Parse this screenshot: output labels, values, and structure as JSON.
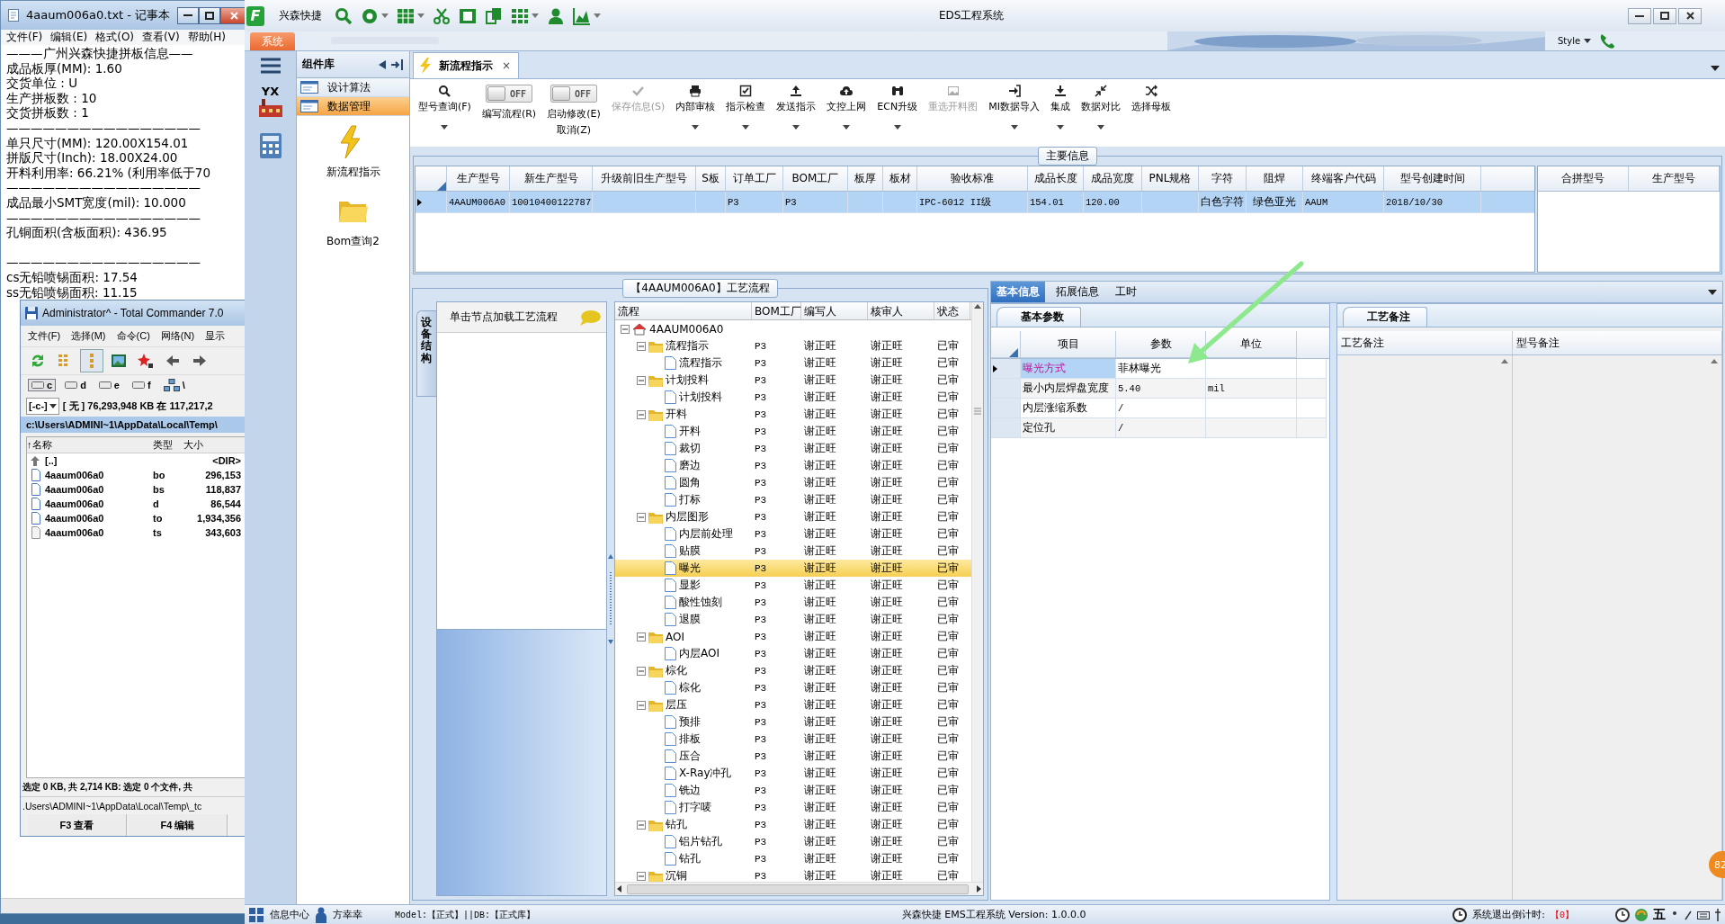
{
  "notepad": {
    "title": "4aaum006a0.txt - 记事本",
    "menu": [
      "文件(F)",
      "编辑(E)",
      "格式(O)",
      "查看(V)",
      "帮助(H)"
    ],
    "paragraphs": [
      [
        "———广州兴森快捷拼板信息——",
        "成品板厚(MM): 1.60",
        "交货单位 : U",
        "生产拼板数 : 10",
        "交货拼板数 : 1",
        "————————————————",
        "单只尺寸(MM): 120.00X154.01",
        "拼版尺寸(Inch): 18.00X24.00",
        "开料利用率: 66.21% (利用率低于70",
        "————————————————",
        "成品最小SMT宽度(mil): 10.000",
        "————————————————",
        "孔铜面积(含板面积): 436.95"
      ],
      [
        "————————————————",
        "cs无铅喷锡面积: 17.54",
        "ss无铅喷锡面积: 11.15"
      ]
    ]
  },
  "total_commander": {
    "title": "Administrator^ - Total Commander 7.0",
    "menu": [
      "文件(F)",
      "选择(M)",
      "命令(C)",
      "网络(N)",
      "显示"
    ],
    "tools": [
      {
        "selected": false
      },
      {
        "selected": false
      },
      {
        "selected": true
      },
      {
        "selected": false
      },
      {
        "selected": false
      },
      {
        "selected": false
      },
      {
        "selected": false
      }
    ],
    "drives": [
      {
        "label": "c",
        "selected": true
      },
      {
        "label": "d",
        "selected": false
      },
      {
        "label": "e",
        "selected": false
      },
      {
        "label": "f",
        "selected": false
      }
    ],
    "root": "\\",
    "drive_select": "[-c-]",
    "free_space": "[ 无 ]  76,293,948 KB 在 117,217,2",
    "path": "c:\\Users\\ADMINI~1\\AppData\\Local\\Temp\\",
    "columns": [
      "↑名称",
      "类型",
      "大小"
    ],
    "files": [
      {
        "kind": "up",
        "name": "[..]",
        "size": "<DIR>"
      },
      {
        "kind": "file",
        "name": "4aaum006a0",
        "type": "bo",
        "size": "296,153"
      },
      {
        "kind": "file",
        "name": "4aaum006a0",
        "type": "bs",
        "size": "118,837"
      },
      {
        "kind": "file",
        "name": "4aaum006a0",
        "type": "d",
        "size": "86,544"
      },
      {
        "kind": "file",
        "name": "4aaum006a0",
        "type": "to",
        "size": "1,934,356"
      },
      {
        "kind": "md",
        "name": "4aaum006a0",
        "type": "ts",
        "size": "343,603"
      }
    ],
    "status": "选定 0 KB, 共 2,714 KB: 选定 0 个文件, 共",
    "command_path": ".Users\\ADMINI~1\\AppData\\Local\\Temp\\_tc",
    "function_keys": [
      "F3 查看",
      "F4 编辑"
    ]
  },
  "app": {
    "logo_letter": "F",
    "name": "兴森快捷",
    "title": "EDS工程系统",
    "quick_tools": [
      {
        "menu": false
      },
      {
        "menu": true
      },
      {
        "menu": true
      },
      {
        "menu": false
      },
      {
        "menu": false
      },
      {
        "menu": false
      },
      {
        "menu": true
      },
      {
        "menu": false
      },
      {
        "menu": true
      }
    ],
    "system_tab": "系统",
    "style_menu": "Style",
    "nav_brand": "YX",
    "components": {
      "title": "组件库",
      "groups": [
        {
          "label": "设计算法",
          "selected": false
        },
        {
          "label": "数据管理",
          "selected": true
        }
      ],
      "shortcuts": [
        {
          "kind": "lightning",
          "label": "新流程指示"
        },
        {
          "kind": "folder",
          "label": "Bom查询2"
        }
      ]
    },
    "document_tab": {
      "label": "新流程指示",
      "close": "×"
    },
    "toolbar": [
      {
        "kind": "button",
        "label": "型号查询(F)",
        "menu": true,
        "disabled": false
      },
      {
        "kind": "toggle",
        "label": "编写流程(R)",
        "switch_text": "OFF",
        "on": false
      },
      {
        "kind": "toggle",
        "label": "启动修改(E)",
        "second_line": "取消(Z)",
        "switch_text": "OFF",
        "on": false
      },
      {
        "kind": "button",
        "label": "保存信息(S)",
        "menu": false,
        "disabled": true
      },
      {
        "kind": "button",
        "label": "内部审核",
        "menu": true,
        "disabled": false
      },
      {
        "kind": "button",
        "label": "指示检查",
        "menu": true,
        "disabled": false
      },
      {
        "kind": "button",
        "label": "发送指示",
        "menu": true,
        "disabled": false
      },
      {
        "kind": "button",
        "label": "文控上网",
        "menu": true,
        "disabled": false
      },
      {
        "kind": "button",
        "label": "ECN升级",
        "menu": true,
        "disabled": false
      },
      {
        "kind": "button",
        "label": "重选开料图",
        "menu": false,
        "disabled": true
      },
      {
        "kind": "button",
        "label": "MI数据导入",
        "menu": true,
        "disabled": false
      },
      {
        "kind": "button",
        "label": "集成",
        "menu": true,
        "disabled": false
      },
      {
        "kind": "button",
        "label": "数据对比",
        "menu": true,
        "disabled": false
      },
      {
        "kind": "button",
        "label": "选择母板",
        "menu": false,
        "disabled": false
      }
    ],
    "main_info": {
      "legend": "主要信息",
      "columns": [
        "生产型号",
        "新生产型号",
        "升级前旧生产型号",
        "S板",
        "订单工厂",
        "BOM工厂",
        "板厚",
        "板材",
        "验收标准",
        "成品长度",
        "成品宽度",
        "PNL规格",
        "字符",
        "阻焊",
        "终端客户代码",
        "型号创建时间"
      ],
      "rows": [
        {
          "selected": true,
          "cells": [
            "4AAUM006A0",
            "10010400122787",
            null,
            null,
            "P3",
            "P3",
            null,
            null,
            "IPC-6012 II级",
            "154.01",
            "120.00",
            null,
            "白色字符",
            "绿色亚光",
            "AAUM",
            "2018/10/30"
          ]
        }
      ],
      "merge_columns": [
        "合拼型号",
        "生产型号"
      ]
    },
    "process": {
      "legend": "【4AAUM006A0】工艺流程",
      "side_tab": "设备结构",
      "hint": "单击节点加载工艺流程",
      "columns": [
        "流程",
        "BOM工厂",
        "编写人",
        "核审人",
        "状态"
      ],
      "tree": {
        "name": "4AAUM006A0",
        "selected": false,
        "expanded": true,
        "children": [
          {
            "name": "流程指示",
            "bom": "P3",
            "writer": "谢正旺",
            "reviewer": "谢正旺",
            "status": "已审",
            "selected": false,
            "expanded": true,
            "children": [
              {
                "name": "流程指示",
                "bom": "P3",
                "writer": "谢正旺",
                "reviewer": "谢正旺",
                "status": "已审",
                "selected": false
              }
            ]
          },
          {
            "name": "计划投料",
            "bom": "P3",
            "writer": "谢正旺",
            "reviewer": "谢正旺",
            "status": "已审",
            "selected": false,
            "expanded": true,
            "children": [
              {
                "name": "计划投料",
                "bom": "P3",
                "writer": "谢正旺",
                "reviewer": "谢正旺",
                "status": "已审",
                "selected": false
              }
            ]
          },
          {
            "name": "开料",
            "bom": "P3",
            "writer": "谢正旺",
            "reviewer": "谢正旺",
            "status": "已审",
            "selected": false,
            "expanded": true,
            "children": [
              {
                "name": "开料",
                "bom": "P3",
                "writer": "谢正旺",
                "reviewer": "谢正旺",
                "status": "已审",
                "selected": false
              },
              {
                "name": "裁切",
                "bom": "P3",
                "writer": "谢正旺",
                "reviewer": "谢正旺",
                "status": "已审",
                "selected": false
              },
              {
                "name": "磨边",
                "bom": "P3",
                "writer": "谢正旺",
                "reviewer": "谢正旺",
                "status": "已审",
                "selected": false
              },
              {
                "name": "圆角",
                "bom": "P3",
                "writer": "谢正旺",
                "reviewer": "谢正旺",
                "status": "已审",
                "selected": false
              },
              {
                "name": "打标",
                "bom": "P3",
                "writer": "谢正旺",
                "reviewer": "谢正旺",
                "status": "已审",
                "selected": false
              }
            ]
          },
          {
            "name": "内层图形",
            "bom": "P3",
            "writer": "谢正旺",
            "reviewer": "谢正旺",
            "status": "已审",
            "selected": false,
            "expanded": true,
            "children": [
              {
                "name": "内层前处理",
                "bom": "P3",
                "writer": "谢正旺",
                "reviewer": "谢正旺",
                "status": "已审",
                "selected": false
              },
              {
                "name": "贴膜",
                "bom": "P3",
                "writer": "谢正旺",
                "reviewer": "谢正旺",
                "status": "已审",
                "selected": false
              },
              {
                "name": "曝光",
                "bom": "P3",
                "writer": "谢正旺",
                "reviewer": "谢正旺",
                "status": "已审",
                "selected": true
              },
              {
                "name": "显影",
                "bom": "P3",
                "writer": "谢正旺",
                "reviewer": "谢正旺",
                "status": "已审",
                "selected": false
              },
              {
                "name": "酸性蚀刻",
                "bom": "P3",
                "writer": "谢正旺",
                "reviewer": "谢正旺",
                "status": "已审",
                "selected": false
              },
              {
                "name": "退膜",
                "bom": "P3",
                "writer": "谢正旺",
                "reviewer": "谢正旺",
                "status": "已审",
                "selected": false
              }
            ]
          },
          {
            "name": "AOI",
            "bom": "P3",
            "writer": "谢正旺",
            "reviewer": "谢正旺",
            "status": "已审",
            "selected": false,
            "expanded": true,
            "children": [
              {
                "name": "内层AOI",
                "bom": "P3",
                "writer": "谢正旺",
                "reviewer": "谢正旺",
                "status": "已审",
                "selected": false
              }
            ]
          },
          {
            "name": "棕化",
            "bom": "P3",
            "writer": "谢正旺",
            "reviewer": "谢正旺",
            "status": "已审",
            "selected": false,
            "expanded": true,
            "children": [
              {
                "name": "棕化",
                "bom": "P3",
                "writer": "谢正旺",
                "reviewer": "谢正旺",
                "status": "已审",
                "selected": false
              }
            ]
          },
          {
            "name": "层压",
            "bom": "P3",
            "writer": "谢正旺",
            "reviewer": "谢正旺",
            "status": "已审",
            "selected": false,
            "expanded": true,
            "children": [
              {
                "name": "预排",
                "bom": "P3",
                "writer": "谢正旺",
                "reviewer": "谢正旺",
                "status": "已审",
                "selected": false
              },
              {
                "name": "排板",
                "bom": "P3",
                "writer": "谢正旺",
                "reviewer": "谢正旺",
                "status": "已审",
                "selected": false
              },
              {
                "name": "压合",
                "bom": "P3",
                "writer": "谢正旺",
                "reviewer": "谢正旺",
                "status": "已审",
                "selected": false
              },
              {
                "name": "X-Ray冲孔",
                "bom": "P3",
                "writer": "谢正旺",
                "reviewer": "谢正旺",
                "status": "已审",
                "selected": false
              },
              {
                "name": "铣边",
                "bom": "P3",
                "writer": "谢正旺",
                "reviewer": "谢正旺",
                "status": "已审",
                "selected": false
              },
              {
                "name": "打字唛",
                "bom": "P3",
                "writer": "谢正旺",
                "reviewer": "谢正旺",
                "status": "已审",
                "selected": false
              }
            ]
          },
          {
            "name": "钻孔",
            "bom": "P3",
            "writer": "谢正旺",
            "reviewer": "谢正旺",
            "status": "已审",
            "selected": false,
            "expanded": true,
            "children": [
              {
                "name": "铝片钻孔",
                "bom": "P3",
                "writer": "谢正旺",
                "reviewer": "谢正旺",
                "status": "已审",
                "selected": false
              },
              {
                "name": "钻孔",
                "bom": "P3",
                "writer": "谢正旺",
                "reviewer": "谢正旺",
                "status": "已审",
                "selected": false
              }
            ]
          },
          {
            "name": "沉铜",
            "bom": "P3",
            "writer": "谢正旺",
            "reviewer": "谢正旺",
            "status": "已审",
            "selected": false,
            "expanded": true
          }
        ]
      }
    },
    "detail": {
      "tabs": [
        {
          "label": "基本信息",
          "selected": true
        },
        {
          "label": "拓展信息",
          "selected": false
        },
        {
          "label": "工时",
          "selected": false
        }
      ],
      "params": {
        "tab": "基本参数",
        "columns": [
          "项目",
          "参数",
          "单位"
        ],
        "rows": [
          {
            "item": "曝光方式",
            "value": "菲林曝光",
            "selected": true
          },
          {
            "item": "最小内层焊盘宽度",
            "value": "5.40",
            "unit": "mil",
            "selected": false
          },
          {
            "item": "内层涨缩系数",
            "value": "/",
            "selected": false
          },
          {
            "item": "定位孔",
            "value": "/",
            "selected": false
          }
        ]
      },
      "notes": {
        "tab": "工艺备注",
        "columns": [
          "工艺备注",
          "型号备注"
        ]
      }
    },
    "status_bar": {
      "info": "信息中心",
      "user": "方幸幸",
      "model_db": "Model:【正式】||DB:【正式库】",
      "version": "兴森快捷 EMS工程系统 Version: 1.0.0.0",
      "countdown_label": "系统退出倒计时:",
      "countdown": "【0】",
      "ime": "五"
    }
  },
  "badge": "82"
}
